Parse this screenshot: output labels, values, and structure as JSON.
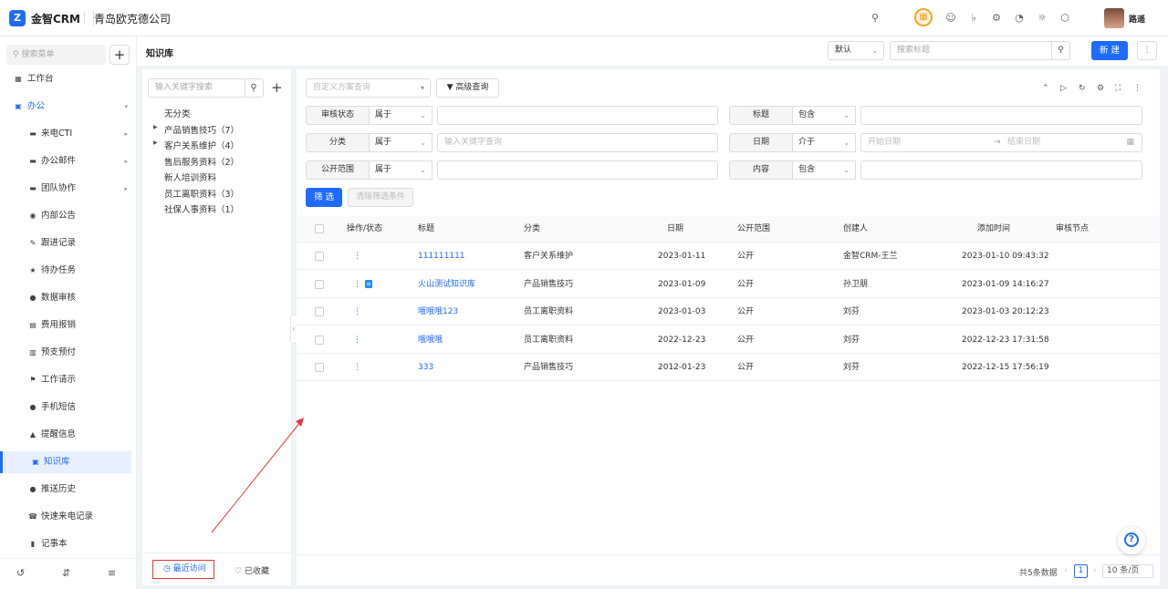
{
  "app": {
    "brand": "金智CRM",
    "company": "青岛欧克德公司",
    "user": "路遥",
    "logo_icon": "crm-logo-icon"
  },
  "topbar_icons": [
    "search-icon",
    "notice-highlight-icon",
    "contacts-icon",
    "bell-icon",
    "settings-icon",
    "pie-chart-icon",
    "compass-icon",
    "hexagon-icon"
  ],
  "sidebar": {
    "search_placeholder": "搜索菜单",
    "plus": "+",
    "items": [
      {
        "label": "工作台",
        "icon": "dashboard-icon",
        "level": "top"
      },
      {
        "label": "办公",
        "icon": "office-icon",
        "level": "top",
        "expanded": true
      },
      {
        "label": "来电CTI",
        "icon": "folder-icon",
        "level": "sub",
        "arrow": true
      },
      {
        "label": "办公邮件",
        "icon": "folder-icon",
        "level": "sub",
        "arrow": true
      },
      {
        "label": "团队协作",
        "icon": "folder-icon",
        "level": "sub",
        "arrow": true
      },
      {
        "label": "内部公告",
        "icon": "megaphone-icon",
        "level": "sub"
      },
      {
        "label": "跟进记录",
        "icon": "edit-icon",
        "level": "sub"
      },
      {
        "label": "待办任务",
        "icon": "pin-icon",
        "level": "sub"
      },
      {
        "label": "数据审核",
        "icon": "user-icon",
        "level": "sub"
      },
      {
        "label": "费用报销",
        "icon": "wallet-icon",
        "level": "sub"
      },
      {
        "label": "预支预付",
        "icon": "money-icon",
        "level": "sub"
      },
      {
        "label": "工作请示",
        "icon": "flag-icon",
        "level": "sub"
      },
      {
        "label": "手机短信",
        "icon": "message-icon",
        "level": "sub"
      },
      {
        "label": "提醒信息",
        "icon": "bell-icon",
        "level": "sub"
      },
      {
        "label": "知识库",
        "icon": "book-icon",
        "level": "sub",
        "active": true
      },
      {
        "label": "推送历史",
        "icon": "history-icon",
        "level": "sub"
      },
      {
        "label": "快速来电记录",
        "icon": "phone-icon",
        "level": "sub"
      },
      {
        "label": "记事本",
        "icon": "notebook-icon",
        "level": "sub"
      }
    ]
  },
  "page": {
    "title": "知识库",
    "view_select": "默认",
    "search_placeholder": "搜索标题",
    "new_button": "新 建"
  },
  "tree": {
    "search_placeholder": "输入关键字搜索",
    "nodes": [
      {
        "label": "无分类",
        "expandable": false
      },
      {
        "label": "产品销售技巧（7）",
        "expandable": true
      },
      {
        "label": "客户关系维护（4）",
        "expandable": true
      },
      {
        "label": "售后服务资料（2）",
        "expandable": false
      },
      {
        "label": "新人培训资料",
        "expandable": false
      },
      {
        "label": "员工离职资料（3）",
        "expandable": false
      },
      {
        "label": "社保人事资料（1）",
        "expandable": false
      }
    ],
    "recent": "最近访问",
    "favorites": "已收藏"
  },
  "filters": {
    "scheme_placeholder": "自定义方案查询",
    "advanced": "高级查询",
    "rows": [
      {
        "label": "审核状态",
        "op": "属于",
        "value": "",
        "label2": "标题",
        "op2": "包含",
        "value2": ""
      },
      {
        "label": "分类",
        "op": "属于",
        "value": "输入关键字查询",
        "label2": "日期",
        "op2": "介于",
        "start": "开始日期",
        "end": "结束日期"
      },
      {
        "label": "公开范围",
        "op": "属于",
        "value": "",
        "label2": "内容",
        "op2": "包含",
        "value2": ""
      }
    ],
    "filter_button": "筛 选",
    "clear_button": "清除筛选条件"
  },
  "table": {
    "columns": [
      "操作/状态",
      "标题",
      "分类",
      "日期",
      "公开范围",
      "创建人",
      "添加时间",
      "审核节点"
    ],
    "rows": [
      {
        "title": "111111111",
        "category": "客户关系维护",
        "date": "2023-01-11",
        "scope": "公开",
        "creator": "金智CRM-王兰",
        "added": "2023-01-10 09:43:32",
        "node": "",
        "doc": false
      },
      {
        "title": "火山测试知识库",
        "category": "产品销售技巧",
        "date": "2023-01-09",
        "scope": "公开",
        "creator": "孙卫朋",
        "added": "2023-01-09 14:16:27",
        "node": "",
        "doc": true
      },
      {
        "title": "哦哦哦123",
        "category": "员工离职资料",
        "date": "2023-01-03",
        "scope": "公开",
        "creator": "刘芬",
        "added": "2023-01-03 20:12:23",
        "node": "",
        "doc": false
      },
      {
        "title": "哦哦哦",
        "category": "员工离职资料",
        "date": "2022-12-23",
        "scope": "公开",
        "creator": "刘芬",
        "added": "2022-12-23 17:31:58",
        "node": "",
        "doc": false
      },
      {
        "title": "333",
        "category": "产品销售技巧",
        "date": "2012-01-23",
        "scope": "公开",
        "creator": "刘芬",
        "added": "2022-12-15 17:56:19",
        "node": "",
        "doc": false
      }
    ]
  },
  "pagination": {
    "total": "共5条数据",
    "page": "1",
    "page_size": "10 条/页"
  },
  "help": "?",
  "colors": {
    "accent": "#1f6bff",
    "annotation": "#e53935"
  }
}
